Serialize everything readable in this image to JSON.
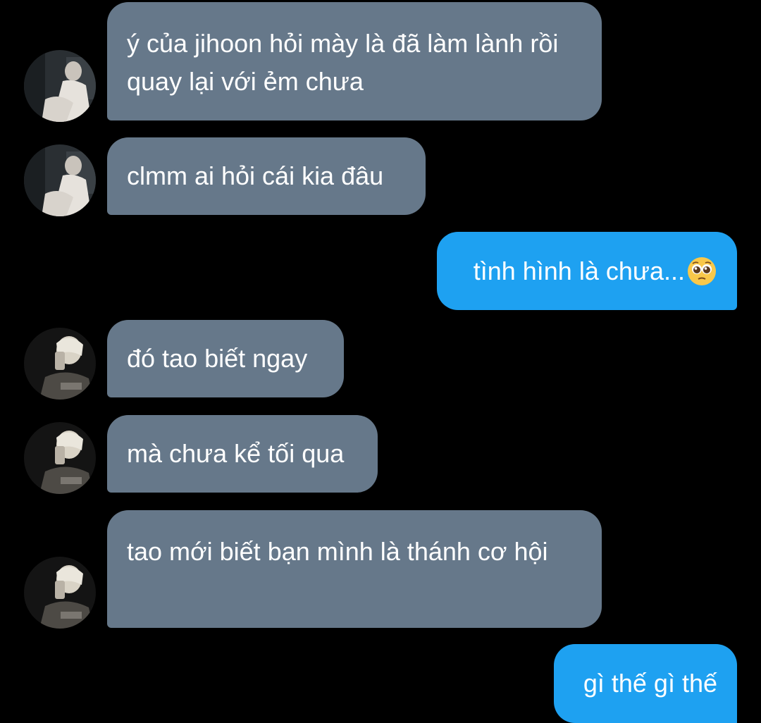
{
  "messages": [
    {
      "id": 1,
      "direction": "incoming",
      "avatar": "profile-photo-a",
      "text": "ý của jihoon hỏi mày là đã làm lành rồi quay lại với ẻm chưa"
    },
    {
      "id": 2,
      "direction": "incoming",
      "avatar": "profile-photo-a",
      "text": "clmm ai hỏi cái kia đâu"
    },
    {
      "id": 3,
      "direction": "outgoing",
      "text": "tình hình là chưa...",
      "emoji": "pleading-face-icon"
    },
    {
      "id": 4,
      "direction": "incoming",
      "avatar": "profile-photo-b",
      "text": "đó tao biết ngay"
    },
    {
      "id": 5,
      "direction": "incoming",
      "avatar": "profile-photo-b",
      "text": "mà chưa kể tối qua"
    },
    {
      "id": 6,
      "direction": "incoming",
      "avatar": "profile-photo-b",
      "text": "tao mới biết bạn mình là thánh cơ hội"
    },
    {
      "id": 7,
      "direction": "outgoing",
      "text": "gì thế gì thế"
    }
  ],
  "colors": {
    "background": "#000000",
    "incoming_bubble": "#66788a",
    "outgoing_bubble": "#1ea1f1",
    "text": "#ffffff"
  }
}
